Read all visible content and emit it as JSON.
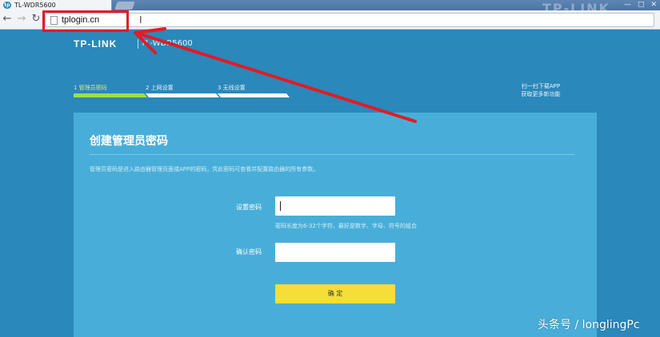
{
  "browser": {
    "tab_title": "TL-WDR5600",
    "url": "tplogin.cn",
    "watermark_top": "TP-LINK",
    "window_controls": [
      "—",
      "□",
      "✕"
    ]
  },
  "header": {
    "brand": "TP-LINK",
    "model": "TL-WDR5600"
  },
  "steps": [
    {
      "label": "1 管理员密码"
    },
    {
      "label": "2 上网设置"
    },
    {
      "label": "3 无线设置"
    }
  ],
  "app_promo": {
    "line1": "扫一扫下载APP",
    "line2": "获取更多新功能"
  },
  "panel": {
    "title": "创建管理员密码",
    "description": "管理员密码是进入路由器管理页面或APP的密码，凭此密码可查看并配置路由器的所有参数。",
    "password_label": "设置密码",
    "password_value": "",
    "hint": "密码长度为6-32个字符，最好是数字、字母、符号的组合",
    "confirm_label": "确认密码",
    "confirm_value": "",
    "button_label": "确 定"
  },
  "watermark": "头条号 / longlingPc",
  "colors": {
    "page_bg": "#2a88ba",
    "panel_bg": "#48aed9",
    "active_step": "#9fdf47",
    "button": "#f6dd38",
    "annotation": "#e21b24"
  }
}
